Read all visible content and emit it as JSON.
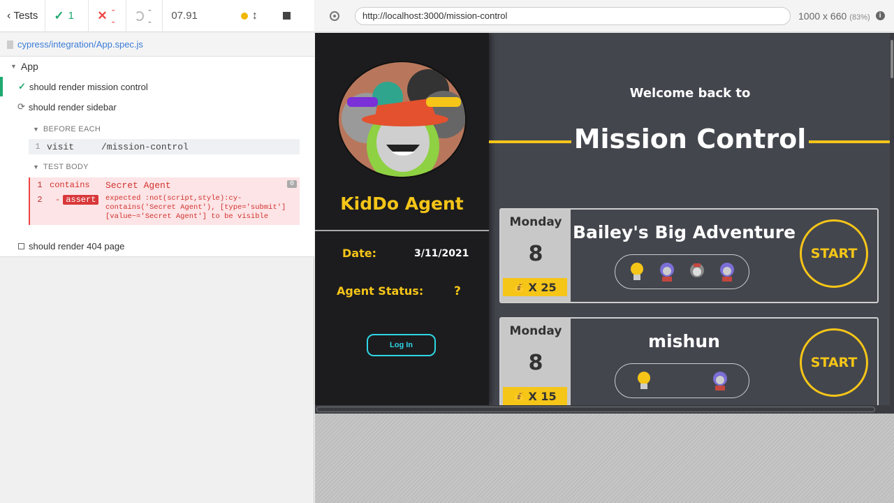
{
  "runner": {
    "tests_label": "Tests",
    "passed": "1",
    "failed": "--",
    "pending": "--",
    "duration": "07.91",
    "spec_path": "cypress/integration/App.spec.js",
    "suite": "App",
    "tests": [
      {
        "title": "should render mission control",
        "state": "passed"
      },
      {
        "title": "should render sidebar",
        "state": "running"
      },
      {
        "title": "should render 404 page",
        "state": "pending"
      }
    ],
    "before_each_label": "BEFORE EACH",
    "before_each_cmd": {
      "num": "1",
      "name": "visit",
      "arg": "/mission-control"
    },
    "test_body_label": "TEST BODY",
    "body_cmds": [
      {
        "num": "1",
        "name": "contains",
        "arg": "Secret Agent"
      },
      {
        "num": "2",
        "name": "-",
        "badge": "assert"
      }
    ],
    "zero_badge": "0",
    "assert_message": "expected :not(script,style):cy-contains('Secret Agent'), [type='submit'][value~='Secret Agent'] to be visible"
  },
  "browser": {
    "url": "http://localhost:3000/mission-control",
    "viewport": "1000 x 660",
    "viewport_pct": "(83%)"
  },
  "app": {
    "agent_name": "KidDo Agent",
    "date_label": "Date:",
    "date_value": "3/11/2021",
    "status_label": "Agent Status:",
    "status_value": "?",
    "login_label": "Log In",
    "welcome": "Welcome back to",
    "title": "Mission Control",
    "cards": [
      {
        "day": "Monday",
        "num": "8",
        "reward": "X 25",
        "title": "Bailey's Big Adventure",
        "start": "START"
      },
      {
        "day": "Monday",
        "num": "8",
        "reward": "X 15",
        "title": "mishun",
        "start": "START"
      }
    ]
  },
  "colors": {
    "accent_yellow": "#f5c518",
    "login_cyan": "#2fd6e6",
    "pass_green": "#1fa971",
    "fail_red": "#e44"
  }
}
